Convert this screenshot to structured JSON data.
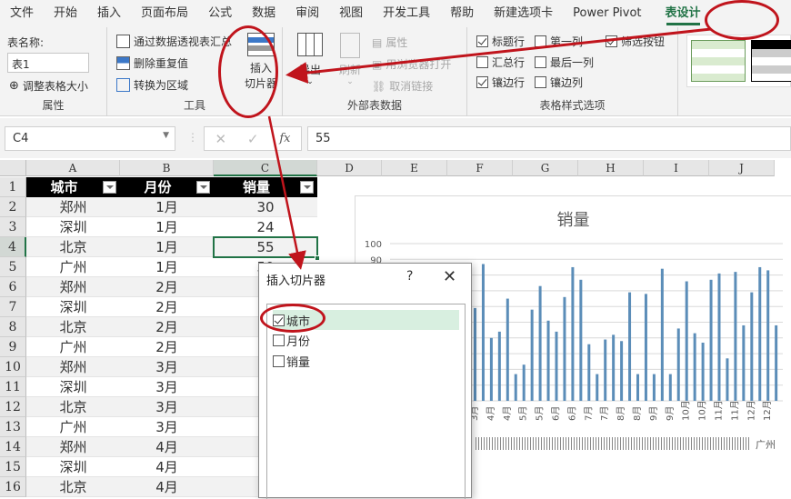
{
  "menubar": {
    "tabs": [
      "文件",
      "开始",
      "插入",
      "页面布局",
      "公式",
      "数据",
      "审阅",
      "视图",
      "开发工具",
      "帮助",
      "新建选项卡",
      "Power Pivot",
      "表设计"
    ],
    "active_tab": "表设计"
  },
  "ribbon": {
    "properties": {
      "label": "属性",
      "table_name_label": "表名称:",
      "table_name_value": "表1",
      "resize_label": "调整表格大小"
    },
    "tools": {
      "label": "工具",
      "pivot_summary": "通过数据透视表汇总",
      "remove_duplicates": "删除重复值",
      "convert_to_range": "转换为区域",
      "insert_slicer_line1": "插入",
      "insert_slicer_line2": "切片器"
    },
    "external": {
      "label": "外部表数据",
      "export": "导出",
      "refresh": "刷新",
      "properties": "属性",
      "open_in_browser": "用浏览器打开",
      "unlink": "取消链接"
    },
    "style_options": {
      "label": "表格样式选项",
      "header_row": {
        "label": "标题行",
        "checked": true
      },
      "first_column": {
        "label": "第一列",
        "checked": false
      },
      "filter_button": {
        "label": "筛选按钮",
        "checked": true
      },
      "total_row": {
        "label": "汇总行",
        "checked": false
      },
      "last_column": {
        "label": "最后一列",
        "checked": false
      },
      "banded_rows": {
        "label": "镶边行",
        "checked": true
      },
      "banded_columns": {
        "label": "镶边列",
        "checked": false
      }
    }
  },
  "formula_bar": {
    "name_box": "C4",
    "cancel": "✕",
    "enter": "✓",
    "fx": "fx",
    "value": "55"
  },
  "sheet": {
    "columns": [
      "A",
      "B",
      "C",
      "D",
      "E",
      "F",
      "G",
      "H",
      "I",
      "J"
    ],
    "selected_column": "C",
    "selected_row": 4,
    "rows": [
      "1",
      "2",
      "3",
      "4",
      "5",
      "6",
      "7",
      "8",
      "9",
      "10",
      "11",
      "12",
      "13",
      "14",
      "15",
      "16"
    ],
    "headers": [
      "城市",
      "月份",
      "销量"
    ],
    "data": [
      [
        "郑州",
        "1月",
        "30"
      ],
      [
        "深圳",
        "1月",
        "24"
      ],
      [
        "北京",
        "1月",
        "55"
      ],
      [
        "广州",
        "1月",
        "50"
      ],
      [
        "郑州",
        "2月",
        ""
      ],
      [
        "深圳",
        "2月",
        ""
      ],
      [
        "北京",
        "2月",
        ""
      ],
      [
        "广州",
        "2月",
        ""
      ],
      [
        "郑州",
        "3月",
        ""
      ],
      [
        "深圳",
        "3月",
        ""
      ],
      [
        "北京",
        "3月",
        ""
      ],
      [
        "广州",
        "3月",
        ""
      ],
      [
        "郑州",
        "4月",
        ""
      ],
      [
        "深圳",
        "4月",
        ""
      ],
      [
        "北京",
        "4月",
        ""
      ]
    ]
  },
  "dialog": {
    "title": "插入切片器",
    "help": "?",
    "close": "✕",
    "fields": [
      {
        "label": "城市",
        "checked": true
      },
      {
        "label": "月份",
        "checked": false
      },
      {
        "label": "销量",
        "checked": false
      }
    ]
  },
  "chart_data": {
    "type": "bar",
    "title": "销量",
    "ylim": [
      0,
      100
    ],
    "yticks_visible": [
      "100",
      "90"
    ],
    "grid": true,
    "bar_color": "#5b8db8",
    "x_month_labels": [
      "3月",
      "4月",
      "4月",
      "5月",
      "5月",
      "6月",
      "6月",
      "7月",
      "7月",
      "8月",
      "8月",
      "9月",
      "9月",
      "10月",
      "10月",
      "11月",
      "11月",
      "12月",
      "12月"
    ],
    "x_city_label_last": "广州",
    "values": [
      59,
      87,
      40,
      44,
      65,
      17,
      23,
      58,
      73,
      51,
      44,
      66,
      85,
      77,
      36,
      17,
      39,
      42,
      38,
      69,
      17,
      68,
      17,
      84,
      17,
      46,
      76,
      43,
      37,
      77,
      81,
      27,
      82,
      48,
      69,
      85,
      83,
      48
    ]
  },
  "colors": {
    "accent": "#217346",
    "annotation": "#c0141c"
  }
}
